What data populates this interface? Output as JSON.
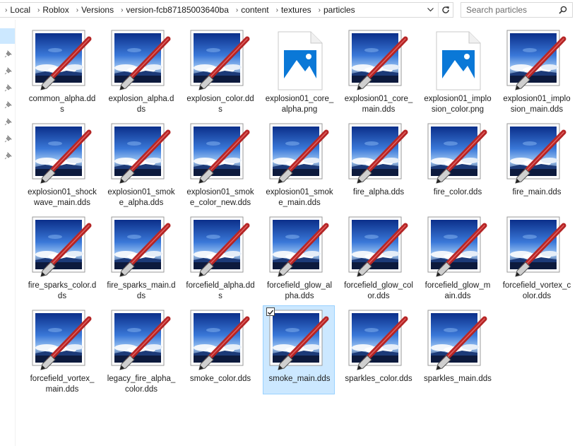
{
  "breadcrumb": [
    "Local",
    "Roblox",
    "Versions",
    "version-fcb87185003640ba",
    "content",
    "textures",
    "particles"
  ],
  "search": {
    "placeholder": "Search particles"
  },
  "files": [
    {
      "name": "common_alpha.dds",
      "type": "dds",
      "selected": false
    },
    {
      "name": "explosion_alpha.dds",
      "type": "dds",
      "selected": false
    },
    {
      "name": "explosion_color.dds",
      "type": "dds",
      "selected": false
    },
    {
      "name": "explosion01_core_alpha.png",
      "type": "png",
      "selected": false
    },
    {
      "name": "explosion01_core_main.dds",
      "type": "dds",
      "selected": false
    },
    {
      "name": "explosion01_implosion_color.png",
      "type": "png",
      "selected": false
    },
    {
      "name": "explosion01_implosion_main.dds",
      "type": "dds",
      "selected": false
    },
    {
      "name": "explosion01_shockwave_main.dds",
      "type": "dds",
      "selected": false
    },
    {
      "name": "explosion01_smoke_alpha.dds",
      "type": "dds",
      "selected": false
    },
    {
      "name": "explosion01_smoke_color_new.dds",
      "type": "dds",
      "selected": false
    },
    {
      "name": "explosion01_smoke_main.dds",
      "type": "dds",
      "selected": false
    },
    {
      "name": "fire_alpha.dds",
      "type": "dds",
      "selected": false
    },
    {
      "name": "fire_color.dds",
      "type": "dds",
      "selected": false
    },
    {
      "name": "fire_main.dds",
      "type": "dds",
      "selected": false
    },
    {
      "name": "fire_sparks_color.dds",
      "type": "dds",
      "selected": false
    },
    {
      "name": "fire_sparks_main.dds",
      "type": "dds",
      "selected": false
    },
    {
      "name": "forcefield_alpha.dds",
      "type": "dds",
      "selected": false
    },
    {
      "name": "forcefield_glow_alpha.dds",
      "type": "dds",
      "selected": false
    },
    {
      "name": "forcefield_glow_color.dds",
      "type": "dds",
      "selected": false
    },
    {
      "name": "forcefield_glow_main.dds",
      "type": "dds",
      "selected": false
    },
    {
      "name": "forcefield_vortex_color.dds",
      "type": "dds",
      "selected": false
    },
    {
      "name": "forcefield_vortex_main.dds",
      "type": "dds",
      "selected": false
    },
    {
      "name": "legacy_fire_alpha_color.dds",
      "type": "dds",
      "selected": false
    },
    {
      "name": "smoke_color.dds",
      "type": "dds",
      "selected": false
    },
    {
      "name": "smoke_main.dds",
      "type": "dds",
      "selected": true
    },
    {
      "name": "sparkles_color.dds",
      "type": "dds",
      "selected": false
    },
    {
      "name": "sparkles_main.dds",
      "type": "dds",
      "selected": false
    }
  ],
  "icons": {
    "dds": "paint-image-icon",
    "png": "photos-app-icon",
    "refresh": "refresh-icon",
    "search": "search-icon",
    "dropdown": "chevron-down-icon",
    "pin": "pin-icon"
  },
  "colors": {
    "selection": "#cce8ff",
    "selection_border": "#99d1ff",
    "png_blue": "#0a78d7"
  }
}
